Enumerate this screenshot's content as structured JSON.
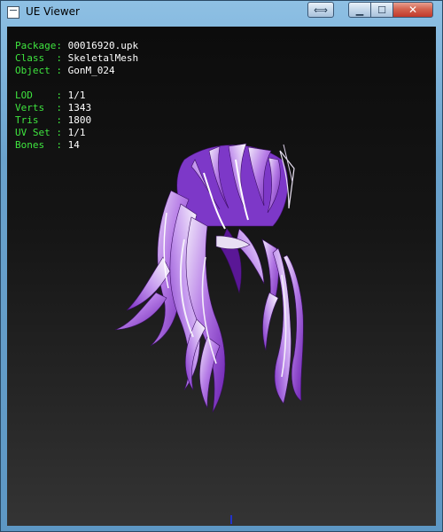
{
  "window": {
    "title": "UE Viewer",
    "buttons": {
      "restore": "⟺",
      "minimize": "▁",
      "maximize": "☐",
      "close": "✕"
    }
  },
  "info": {
    "package": {
      "label": "Package",
      "sep": ": ",
      "value": "00016920.upk"
    },
    "class": {
      "label": "Class  ",
      "sep": ": ",
      "value": "SkeletalMesh"
    },
    "object": {
      "label": "Object ",
      "sep": ": ",
      "value": "GonM_024"
    },
    "lod": {
      "label": "LOD    ",
      "sep": ": ",
      "value": "1/1"
    },
    "verts": {
      "label": "Verts  ",
      "sep": ": ",
      "value": "1343"
    },
    "tris": {
      "label": "Tris   ",
      "sep": ": ",
      "value": "1800"
    },
    "uvset": {
      "label": "UV Set ",
      "sep": ": ",
      "value": "1/1"
    },
    "bones": {
      "label": "Bones  ",
      "sep": ": ",
      "value": "14"
    }
  },
  "colors": {
    "label": "#3fe53f",
    "value": "#ffffff",
    "mesh_main": "#9a3fd6",
    "mesh_highlight": "#e6d8f5",
    "background_top": "#0c0c0c",
    "background_bottom": "#343434"
  }
}
